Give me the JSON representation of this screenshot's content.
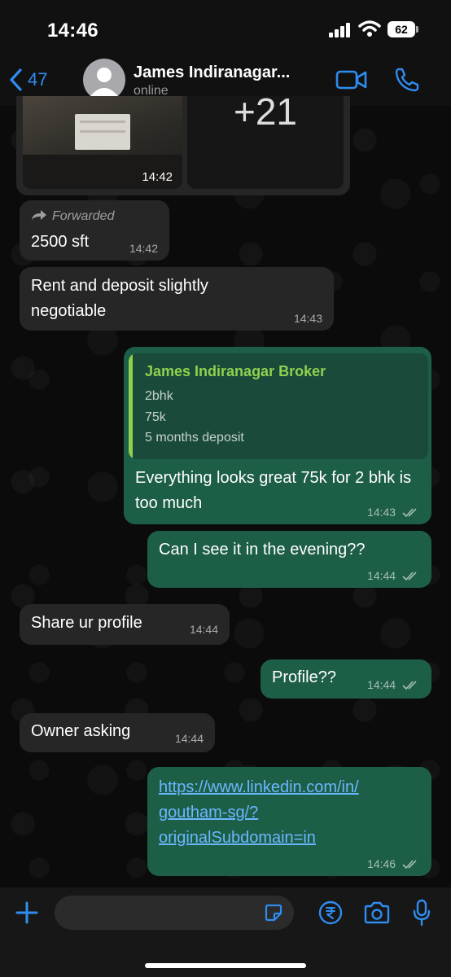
{
  "status_bar": {
    "time": "14:46",
    "battery": "62"
  },
  "header": {
    "back_count": "47",
    "contact_name": "James Indiranagar...",
    "contact_status": "online"
  },
  "media": {
    "time": "14:42",
    "more_count": "+21"
  },
  "messages": [
    {
      "forwarded_label": "Forwarded",
      "text": "2500 sft",
      "time": "14:42"
    },
    {
      "text": "Rent and deposit slightly negotiable",
      "time": "14:43"
    },
    {
      "quote_name": "James Indiranagar  Broker",
      "quote_lines": [
        "2bhk",
        "75k",
        "5 months deposit"
      ],
      "text": "Everything looks great 75k for 2 bhk is too much",
      "time": "14:43"
    },
    {
      "text": "Can I see it in the evening??",
      "time": "14:44"
    },
    {
      "text": "Share ur profile",
      "time": "14:44"
    },
    {
      "text": "Profile??",
      "time": "14:44"
    },
    {
      "text": "Owner asking",
      "time": "14:44"
    },
    {
      "link_lines": [
        "https://www.linkedin.com/in/",
        "goutham-sg/?",
        "originalSubdomain=in"
      ],
      "time": "14:46"
    }
  ],
  "colors": {
    "accent": "#2f8cf0",
    "outgoing_bubble": "#1d5e47",
    "incoming_bubble": "#262626",
    "quote_name": "#8fd14f",
    "link": "#6ab7ff"
  },
  "icons": {
    "back": "chevron-left-icon",
    "video": "video-camera-icon",
    "call": "phone-icon",
    "attach": "plus-icon",
    "sticker": "sticker-icon",
    "payment": "rupee-icon",
    "camera": "camera-icon",
    "mic": "microphone-icon"
  }
}
